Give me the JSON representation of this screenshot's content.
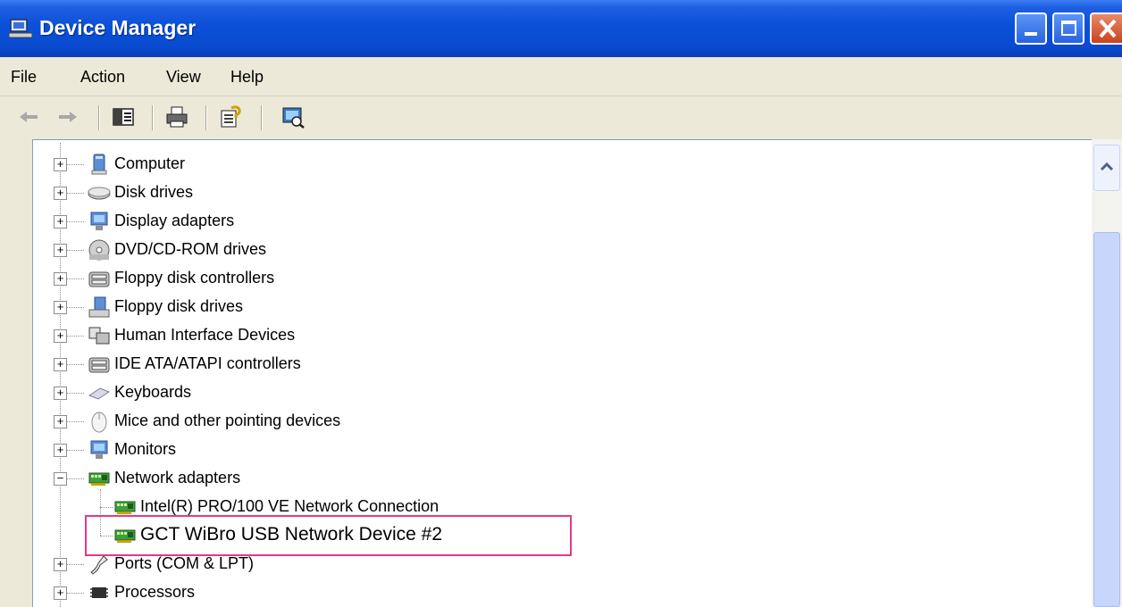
{
  "window": {
    "title": "Device Manager"
  },
  "menu": [
    "File",
    "Action",
    "View",
    "Help"
  ],
  "toolbar": [
    "back-icon",
    "forward-icon",
    "show-hide-console-tree-icon",
    "print-icon",
    "properties-help-icon",
    "scan-hardware-icon"
  ],
  "tree": {
    "items": [
      {
        "label": "Computer",
        "icon": "computer-icon"
      },
      {
        "label": "Disk drives",
        "icon": "disk-drive-icon"
      },
      {
        "label": "Display adapters",
        "icon": "display-adapter-icon"
      },
      {
        "label": "DVD/CD-ROM drives",
        "icon": "cd-drive-icon"
      },
      {
        "label": "Floppy disk controllers",
        "icon": "controller-icon"
      },
      {
        "label": "Floppy disk drives",
        "icon": "floppy-drive-icon"
      },
      {
        "label": "Human Interface Devices",
        "icon": "hid-icon"
      },
      {
        "label": "IDE ATA/ATAPI controllers",
        "icon": "controller-icon"
      },
      {
        "label": "Keyboards",
        "icon": "keyboard-icon"
      },
      {
        "label": "Mice and other pointing devices",
        "icon": "mouse-icon"
      },
      {
        "label": "Monitors",
        "icon": "monitor-icon"
      },
      {
        "label": "Network adapters",
        "icon": "network-adapter-icon",
        "expanded": true
      },
      {
        "label": "Intel(R) PRO/100 VE Network Connection",
        "icon": "network-adapter-icon",
        "child": true
      },
      {
        "label": "GCT WiBro USB Network Device #2",
        "icon": "network-adapter-icon",
        "child": true,
        "highlighted": true
      },
      {
        "label": "Ports (COM & LPT)",
        "icon": "port-icon"
      },
      {
        "label": "Processors",
        "icon": "processor-icon"
      }
    ]
  },
  "colors": {
    "highlight_border": "#e8378a",
    "titlebar": "#0b50d8"
  }
}
